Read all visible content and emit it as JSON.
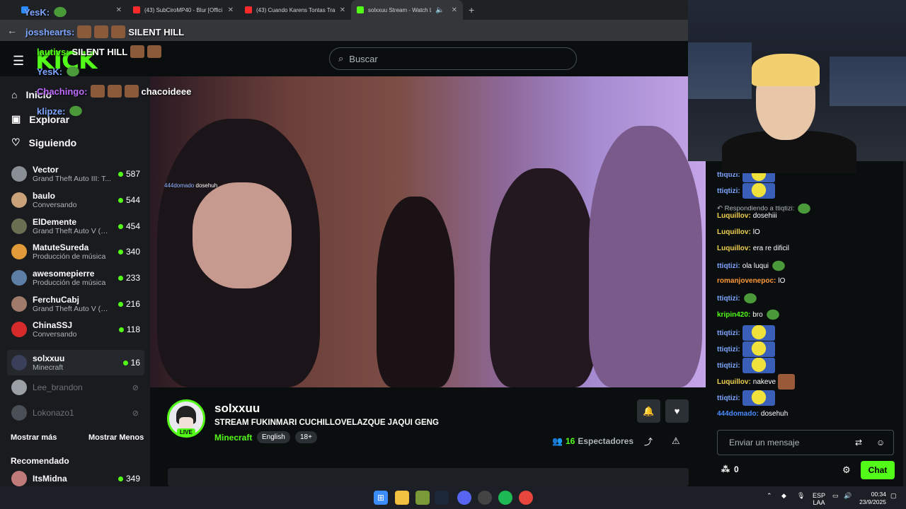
{
  "browser": {
    "tabs": [
      {
        "title": "",
        "color": "#2a8cff"
      },
      {
        "title": "(43) SubCiroMP40 - Blur [Offici",
        "color": "#ff2b2b"
      },
      {
        "title": "(43) Cuando Karens Tontas Trat",
        "color": "#ff2b2b"
      },
      {
        "title": "solxxuu Stream - Watch Liv",
        "color": "#53fc18"
      }
    ],
    "new_tab": "+"
  },
  "header": {
    "logo": "KICK",
    "search_placeholder": "Buscar"
  },
  "sidebar": {
    "nav": [
      {
        "label": "Inicio",
        "icon": "home-icon"
      },
      {
        "label": "Explorar",
        "icon": "explore-icon"
      },
      {
        "label": "Siguiendo",
        "icon": "heart-icon"
      }
    ],
    "channels": [
      {
        "name": "Vector",
        "game": "Grand Theft Auto III: T...",
        "viewers": "587",
        "color": "#8a8f95"
      },
      {
        "name": "baulo",
        "game": "Conversando",
        "viewers": "544",
        "color": "#c9a27a"
      },
      {
        "name": "ElDemente",
        "game": "Grand Theft Auto V (G...",
        "viewers": "454",
        "color": "#6b6f52"
      },
      {
        "name": "MatuteSureda",
        "game": "Producción de música",
        "viewers": "340",
        "color": "#e09a3a"
      },
      {
        "name": "awesomepierre",
        "game": "Producción de música",
        "viewers": "233",
        "color": "#5d7fa6"
      },
      {
        "name": "FerchuCabj",
        "game": "Grand Theft Auto V (G...",
        "viewers": "216",
        "color": "#a07a6a"
      },
      {
        "name": "ChinaSSJ",
        "game": "Conversando",
        "viewers": "118",
        "color": "#d62b2b"
      },
      {
        "name": "solxxuu",
        "game": "Minecraft",
        "viewers": "16",
        "color": "#3a3f5a"
      }
    ],
    "offline": [
      {
        "name": "Lee_brandon",
        "color": "#9aa0a6"
      },
      {
        "name": "Lokonazo1",
        "color": "#4a4f55"
      }
    ],
    "show_more": "Mostrar más",
    "show_less": "Mostrar Menos",
    "recommended_title": "Recomendado",
    "recommended": [
      {
        "name": "ItsMidna",
        "viewers": "349",
        "color": "#c07a7a"
      }
    ]
  },
  "stream": {
    "channel": "solxxuu",
    "title": "STREAM FUKINMARI CUCHILLOVELAZQUE JAQUI GENG",
    "category": "Minecraft",
    "tags": [
      "English",
      "18+"
    ],
    "live_badge": "LIVE",
    "viewers": "16",
    "viewers_label": "Espectadores",
    "video_tag_user": "444domado",
    "video_tag_text": "dosehuh"
  },
  "overlay_chat": [
    {
      "user": "YesK:",
      "text": "",
      "style": "u"
    },
    {
      "user": "josshearts:",
      "text": "SILENT HILL",
      "style": "u"
    },
    {
      "user": "lautivs:",
      "text": "SILENT HILL",
      "style": "g"
    },
    {
      "user": "YesK:",
      "text": "",
      "style": "u"
    },
    {
      "user": "Chachingo:",
      "text": "chacoideee",
      "style": "p"
    },
    {
      "user": "klipze:",
      "text": "",
      "style": "u"
    }
  ],
  "chat": {
    "reply_hint": "Respondiendo a ttiqtizi:",
    "messages": [
      {
        "user": "ttiqtizi:",
        "text": "",
        "color": "#7ea6ff",
        "emote": "yellow"
      },
      {
        "user": "ttiqtizi:",
        "text": "",
        "color": "#7ea6ff",
        "emote": "yellow"
      },
      {
        "user": "Luquillov:",
        "text": "dosehiii",
        "color": "#f0d050",
        "emote": ""
      },
      {
        "user": "Luquillov:",
        "text": "lO",
        "color": "#f0d050",
        "emote": ""
      },
      {
        "user": "Luquillov:",
        "text": "era re dificil",
        "color": "#f0d050",
        "emote": ""
      },
      {
        "user": "ttiqtizi:",
        "text": "ola luqui",
        "color": "#7ea6ff",
        "emote": "pepe"
      },
      {
        "user": "romanjovenepoc:",
        "text": "lO",
        "color": "#ff9a3a",
        "emote": ""
      },
      {
        "user": "ttiqtizi:",
        "text": "",
        "color": "#7ea6ff",
        "emote": "pepe"
      },
      {
        "user": "kripin420:",
        "text": "bro",
        "color": "#53fc18",
        "emote": "pepe"
      },
      {
        "user": "ttiqtizi:",
        "text": "",
        "color": "#7ea6ff",
        "emote": "yellow"
      },
      {
        "user": "ttiqtizi:",
        "text": "",
        "color": "#7ea6ff",
        "emote": "yellow"
      },
      {
        "user": "ttiqtizi:",
        "text": "",
        "color": "#7ea6ff",
        "emote": "yellow"
      },
      {
        "user": "Luquillov:",
        "text": "nakeve",
        "color": "#f0d050",
        "emote": "face"
      },
      {
        "user": "ttiqtizi:",
        "text": "",
        "color": "#7ea6ff",
        "emote": "yellow"
      },
      {
        "user": "444domado:",
        "text": "dosehuh",
        "color": "#4a8aff",
        "emote": ""
      }
    ],
    "input_placeholder": "Enviar un mensaje",
    "points": "0",
    "chat_button": "Chat"
  },
  "taskbar": {
    "lang": "ESP",
    "lang2": "LAA",
    "time": "00:34",
    "date": "23/9/2025"
  },
  "colors": {
    "accent": "#53fc18",
    "bg": "#0b0e0f",
    "sidebar": "#191b1f"
  }
}
